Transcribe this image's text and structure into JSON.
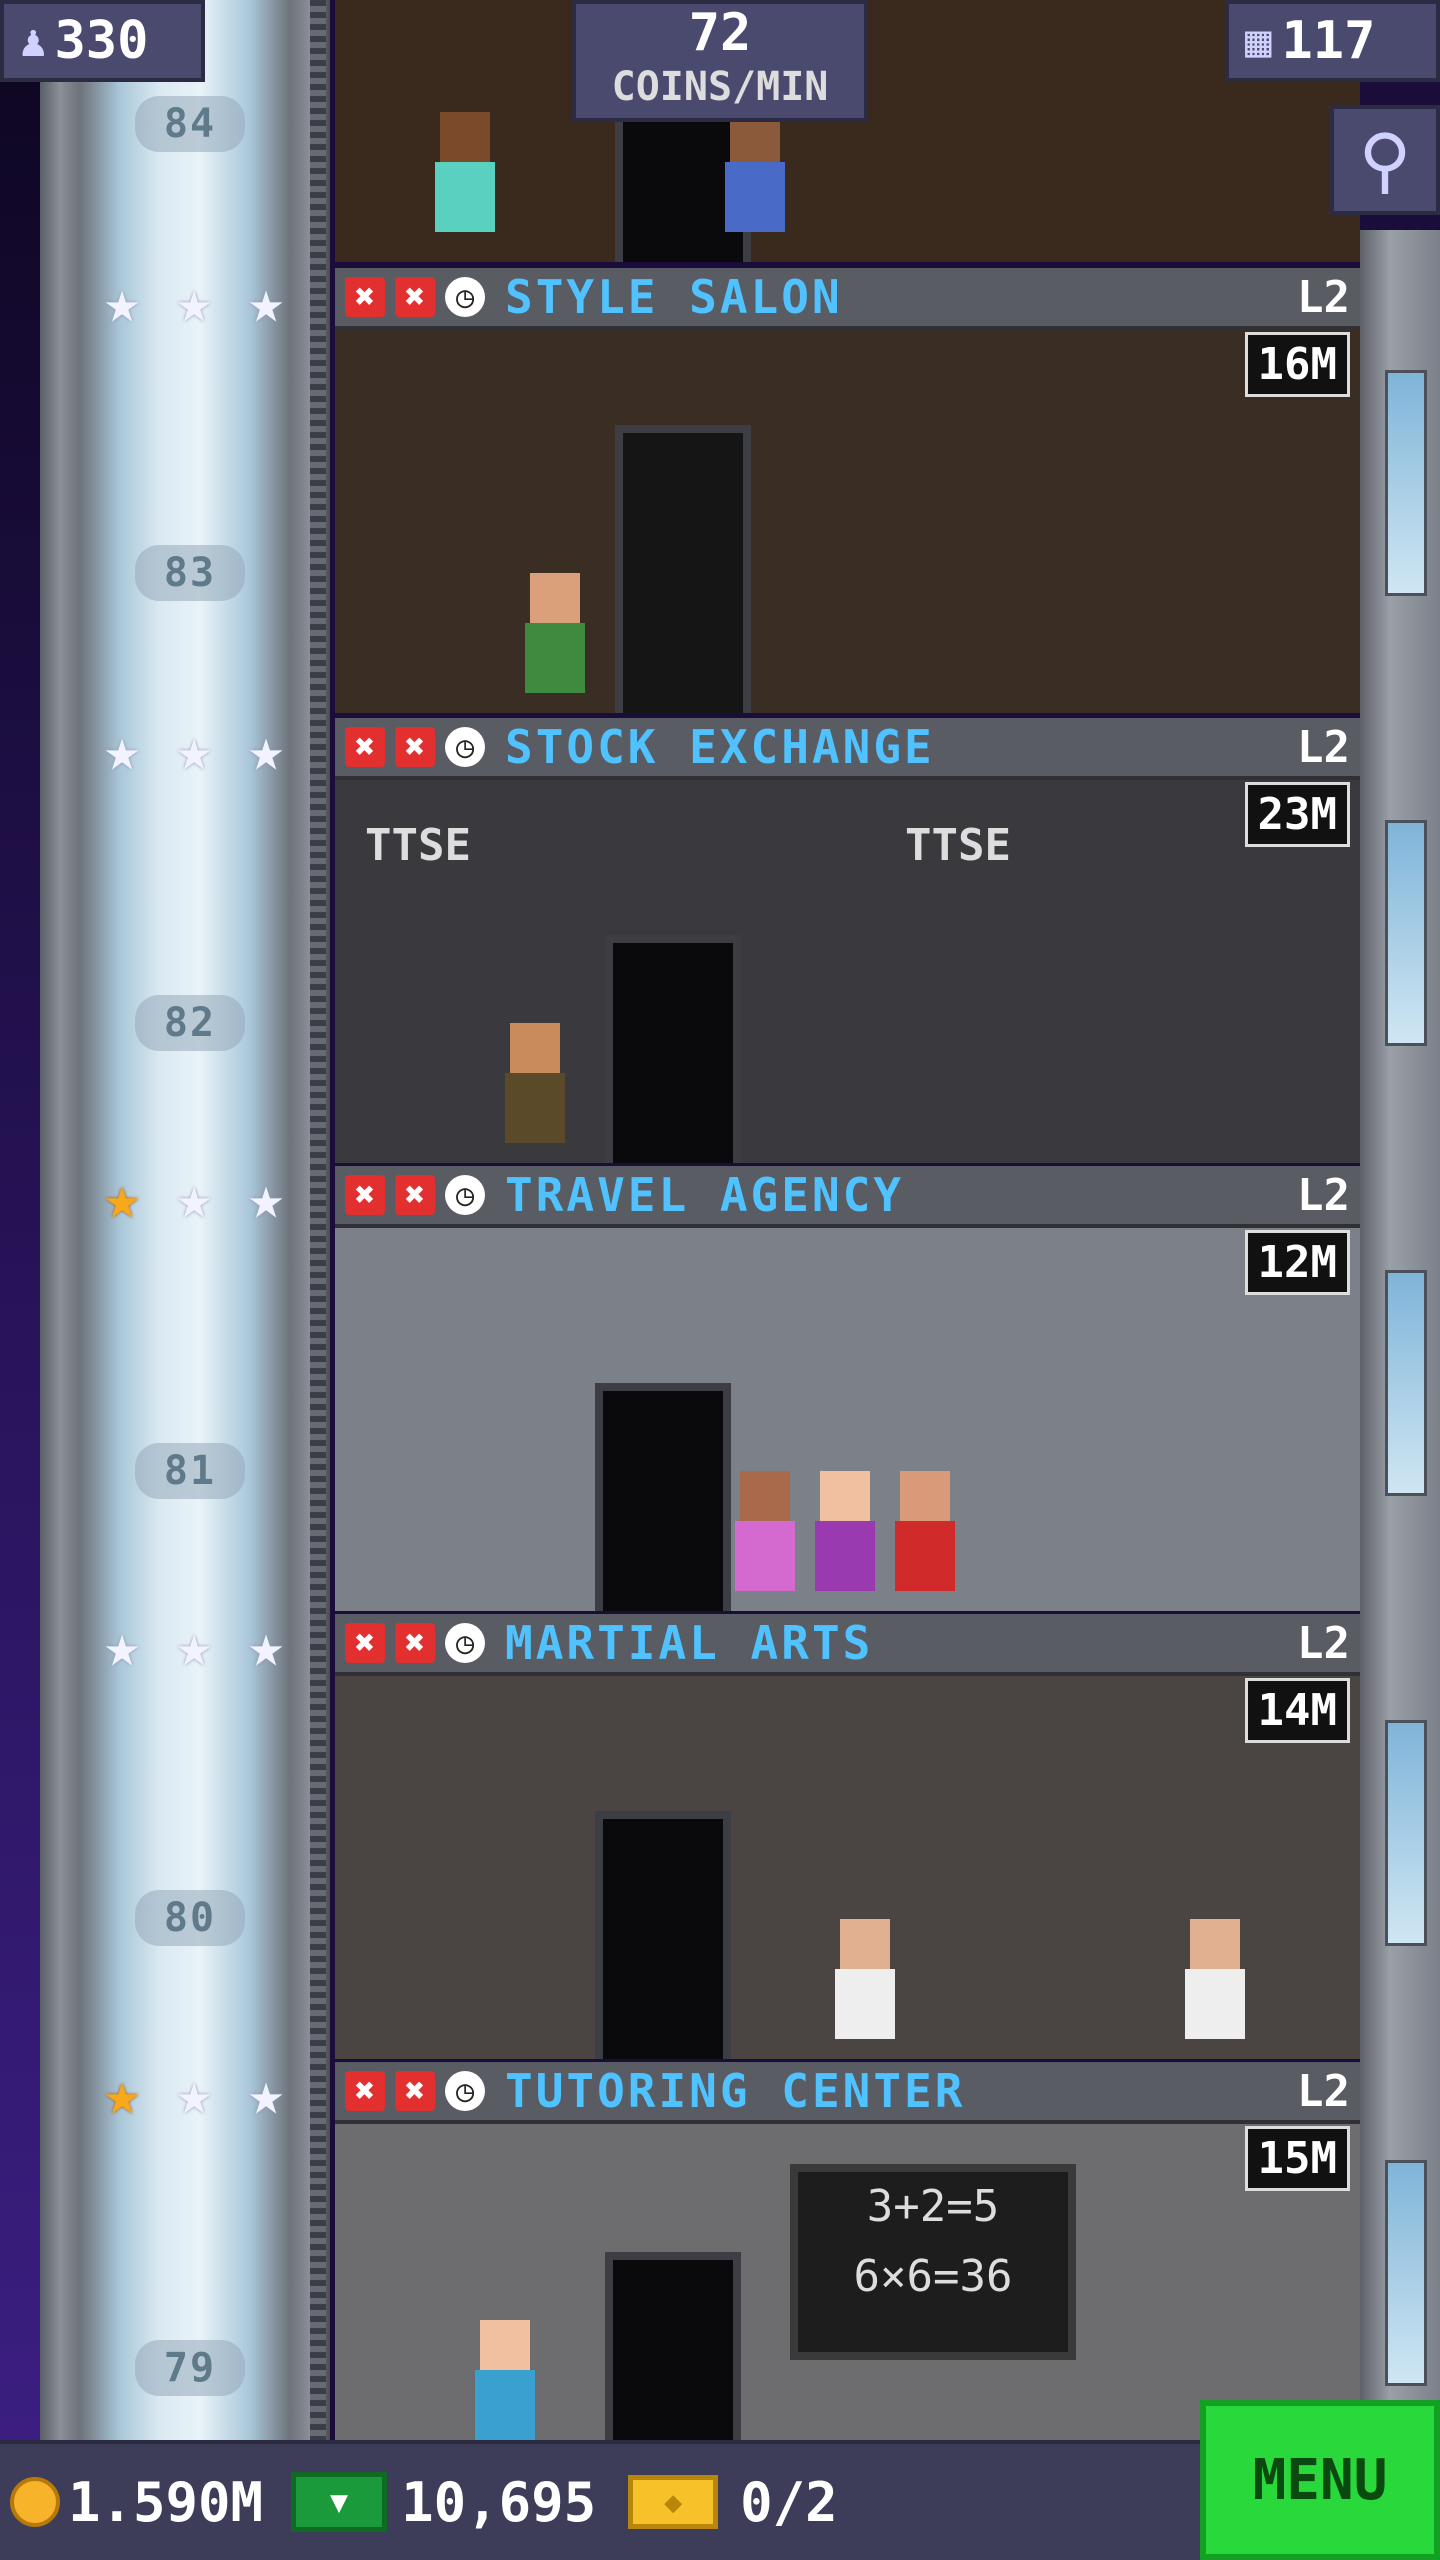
{
  "top": {
    "population": "330",
    "coins_rate_value": "72",
    "coins_rate_unit": "COINS/MIN",
    "floors": "117"
  },
  "floor_numbers": [
    "84",
    "83",
    "82",
    "81",
    "80",
    "79"
  ],
  "rooms": [
    {
      "name": "STYLE SALON",
      "level": "L2",
      "value": "16M",
      "stars_filled": 0,
      "stars_total": 3
    },
    {
      "name": "STOCK EXCHANGE",
      "level": "L2",
      "value": "23M",
      "stars_filled": 0,
      "stars_total": 3,
      "signs": [
        "TTSE",
        "TTSE"
      ]
    },
    {
      "name": "TRAVEL AGENCY",
      "level": "L2",
      "value": "12M",
      "stars_filled": 1,
      "stars_total": 3
    },
    {
      "name": "MARTIAL ARTS",
      "level": "L2",
      "value": "14M",
      "stars_filled": 0,
      "stars_total": 3
    },
    {
      "name": "TUTORING CENTER",
      "level": "L2",
      "value": "15M",
      "stars_filled": 1,
      "stars_total": 3,
      "board": [
        "3+2=5",
        "6×6=36"
      ]
    }
  ],
  "bottom": {
    "coins": "1.590M",
    "bux": "10,695",
    "tickets": "0/2",
    "menu_label": "MENU"
  },
  "colors": {
    "room_name": "#4fc2ff",
    "menu": "#29d83a",
    "star_gold": "#f7a81b"
  }
}
